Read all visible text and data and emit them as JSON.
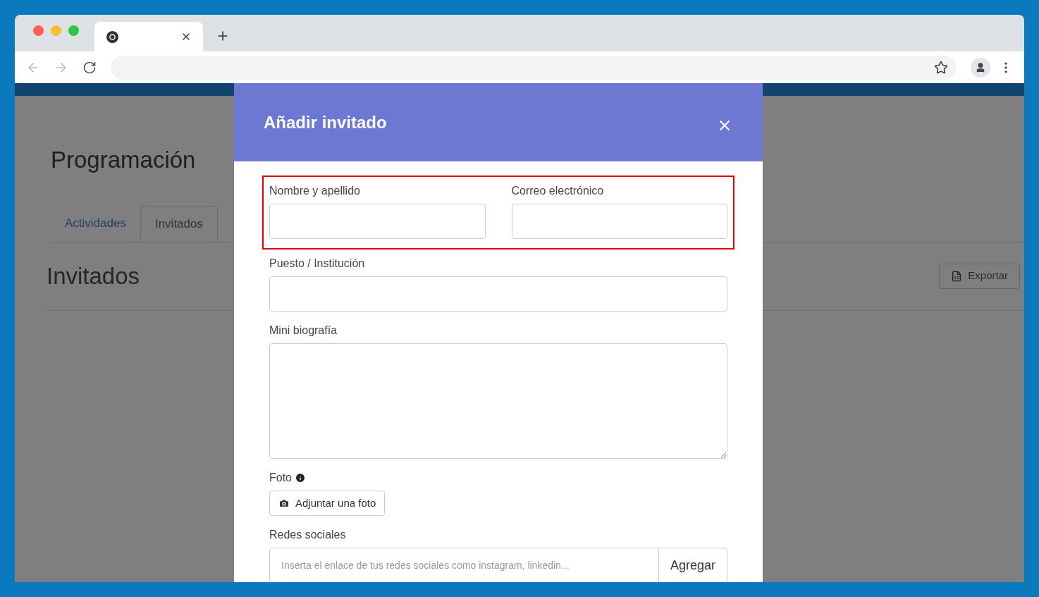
{
  "page": {
    "title": "Programación",
    "tabs": [
      {
        "label": "Actividades",
        "selected": false
      },
      {
        "label": "Invitados",
        "selected": true
      }
    ],
    "section_title": "Invitados",
    "export_button": "Exportar"
  },
  "modal": {
    "title": "Añadir invitado",
    "highlighted_fields": [
      {
        "label": "Nombre y apellido"
      },
      {
        "label": "Correo electrónico"
      }
    ],
    "fields": [
      {
        "kind": "text",
        "label": "Puesto / Institución"
      },
      {
        "kind": "textarea",
        "label": "Mini biografía"
      },
      {
        "kind": "file",
        "label": "Foto",
        "button": "Adjuntar una foto"
      },
      {
        "kind": "addon",
        "label": "Redes sociales",
        "placeholder": "Inserta el enlace de tus redes sociales como instagram, linkedin...",
        "button": "Agregar"
      }
    ]
  }
}
